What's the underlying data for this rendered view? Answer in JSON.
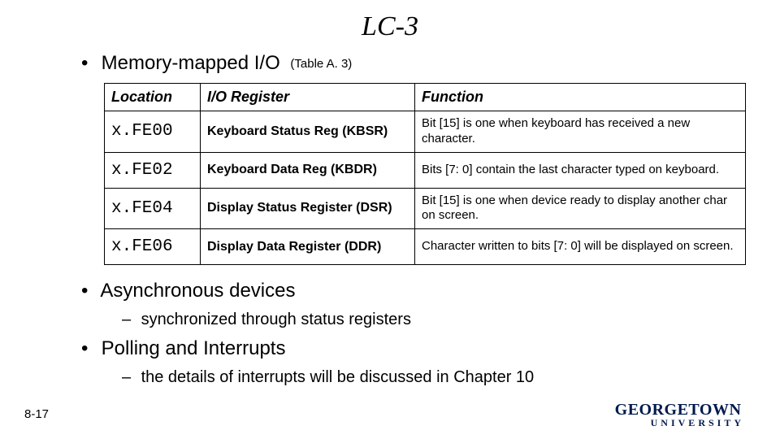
{
  "title": "LC-3",
  "bullet1": {
    "label": "Memory-mapped I/O",
    "ref": "(Table A. 3)"
  },
  "table": {
    "headers": {
      "c1": "Location",
      "c2": "I/O Register",
      "c3": "Function"
    },
    "rows": [
      {
        "loc": "x.FE00",
        "reg": "Keyboard Status Reg (KBSR)",
        "fn": "Bit [15] is one when keyboard has received a new character."
      },
      {
        "loc": "x.FE02",
        "reg": "Keyboard Data Reg (KBDR)",
        "fn": "Bits [7: 0] contain the last character typed on keyboard."
      },
      {
        "loc": "x.FE04",
        "reg": "Display Status Register (DSR)",
        "fn": "Bit [15] is one when device ready to display another char on screen."
      },
      {
        "loc": "x.FE06",
        "reg": "Display Data Register (DDR)",
        "fn": "Character written to bits [7: 0] will be displayed on screen."
      }
    ]
  },
  "bullet2": {
    "label": "Asynchronous devices",
    "sub": "synchronized through status registers"
  },
  "bullet3": {
    "label": "Polling and Interrupts",
    "sub": "the details of interrupts will be discussed in Chapter 10"
  },
  "pagenum": "8-17",
  "logo": {
    "top": "GEORGETOWN",
    "bottom": "UNIVERSITY"
  }
}
